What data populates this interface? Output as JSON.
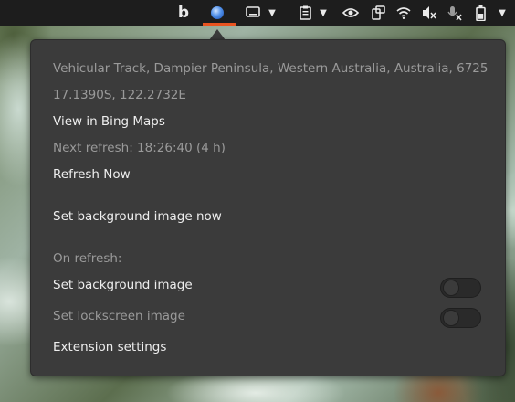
{
  "topbar": {
    "icons": [
      {
        "name": "bing-icon",
        "glyph": "b"
      },
      {
        "name": "bing-wallpaper-globe-icon",
        "glyph": ""
      },
      {
        "name": "display-icon",
        "glyph": "▭"
      },
      {
        "name": "clipboard-icon",
        "glyph": "📋"
      },
      {
        "name": "eye-icon",
        "glyph": "◉"
      },
      {
        "name": "screen-rotate-icon",
        "glyph": "⧉"
      },
      {
        "name": "wifi-icon",
        "glyph": "◠"
      },
      {
        "name": "volume-muted-icon",
        "glyph": "🔇"
      },
      {
        "name": "microphone-muted-icon",
        "glyph": "🎙"
      },
      {
        "name": "battery-icon",
        "glyph": "▮"
      }
    ],
    "caret": "▼"
  },
  "menu": {
    "location": "Vehicular Track, Dampier Peninsula, Western Australia, Australia, 6725",
    "coordinates": "17.1390S, 122.2732E",
    "view_in_maps": "View in Bing Maps",
    "next_refresh": "Next refresh: 18:26:40 (4 h)",
    "refresh_now": "Refresh Now",
    "set_background_now": "Set background image now",
    "on_refresh_label": "On refresh:",
    "set_background_label": "Set background image",
    "set_background_enabled": false,
    "set_lockscreen_label": "Set lockscreen image",
    "set_lockscreen_enabled": false,
    "extension_settings": "Extension settings"
  },
  "colors": {
    "menu_bg": "#3b3b3b",
    "topbar_bg": "#1d1d1d",
    "accent": "#e95420"
  }
}
